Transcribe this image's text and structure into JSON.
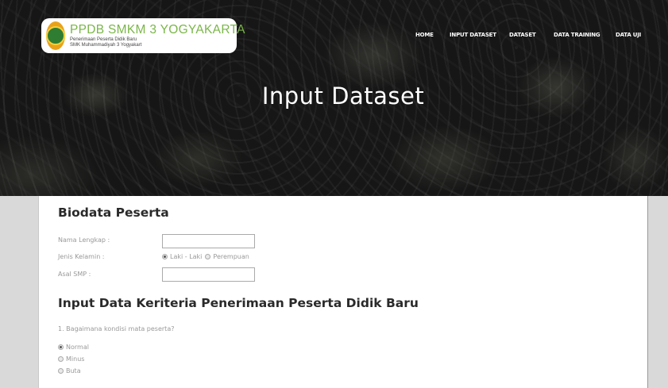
{
  "brand": {
    "title": "PPDB SMKM 3 YOGYAKARTA",
    "subtitle_line1": "Penerimaan Peserta Didik Baru",
    "subtitle_line2": "SMK Muhammadiyah 3 Yogyakart"
  },
  "nav": {
    "items": [
      {
        "label": "HOME"
      },
      {
        "label": "INPUT DATASET"
      },
      {
        "label": "DATASET"
      },
      {
        "label": "DATA TRAINING"
      },
      {
        "label": "DATA UJI"
      }
    ]
  },
  "hero": {
    "title": "Input Dataset"
  },
  "biodata": {
    "heading": "Biodata Peserta",
    "nama_label": "Nama Lengkap :",
    "nama_value": "",
    "jk_label": "Jenis Kelamin :",
    "jk_options": [
      "Laki - Laki",
      "Perempuan"
    ],
    "jk_selected": "Laki - Laki",
    "smp_label": "Asal SMP :",
    "smp_value": ""
  },
  "kriteria": {
    "heading": "Input Data Keriteria Penerimaan Peserta Didik Baru",
    "q1": {
      "text": "1. Bagaimana kondisi mata peserta?",
      "options": [
        "Normal",
        "Minus",
        "Buta"
      ],
      "selected": "Normal"
    }
  },
  "colors": {
    "brand_green": "#7ab648",
    "page_bg": "#d9d9d9",
    "hero_bg": "#1b1b1b"
  }
}
